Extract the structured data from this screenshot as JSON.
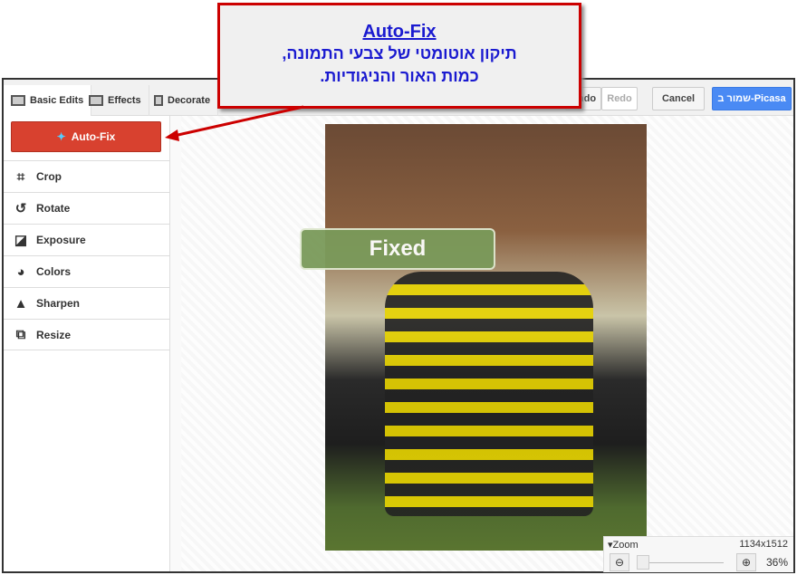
{
  "callout": {
    "title": "Auto-Fix",
    "line1": "תיקון אוטומטי של צבעי התמונה,",
    "line2": "כמות האור והניגודיות."
  },
  "toolbar": {
    "tabs": [
      {
        "label": "Basic Edits",
        "icon": "basic-edits-icon"
      },
      {
        "label": "Effects",
        "icon": "effects-icon"
      },
      {
        "label": "Decorate",
        "icon": "paint-roller-icon"
      }
    ],
    "undo": "Undo",
    "redo": "Redo",
    "cancel": "Cancel",
    "save": "שמור ב-Picasa"
  },
  "sidebar": {
    "autofix": "Auto-Fix",
    "items": [
      {
        "label": "Crop",
        "icon": "crop-icon"
      },
      {
        "label": "Rotate",
        "icon": "rotate-icon"
      },
      {
        "label": "Exposure",
        "icon": "exposure-icon"
      },
      {
        "label": "Colors",
        "icon": "palette-icon"
      },
      {
        "label": "Sharpen",
        "icon": "sharpen-icon"
      },
      {
        "label": "Resize",
        "icon": "resize-icon"
      }
    ]
  },
  "canvas": {
    "overlay": "Fixed"
  },
  "zoom": {
    "label": "Zoom",
    "dimensions": "1134x1512",
    "percent": "36%",
    "slider_value": 0.0
  },
  "colors": {
    "accent_red": "#d8412f",
    "save_blue": "#4a8af4",
    "callout_border": "#cc0000"
  }
}
